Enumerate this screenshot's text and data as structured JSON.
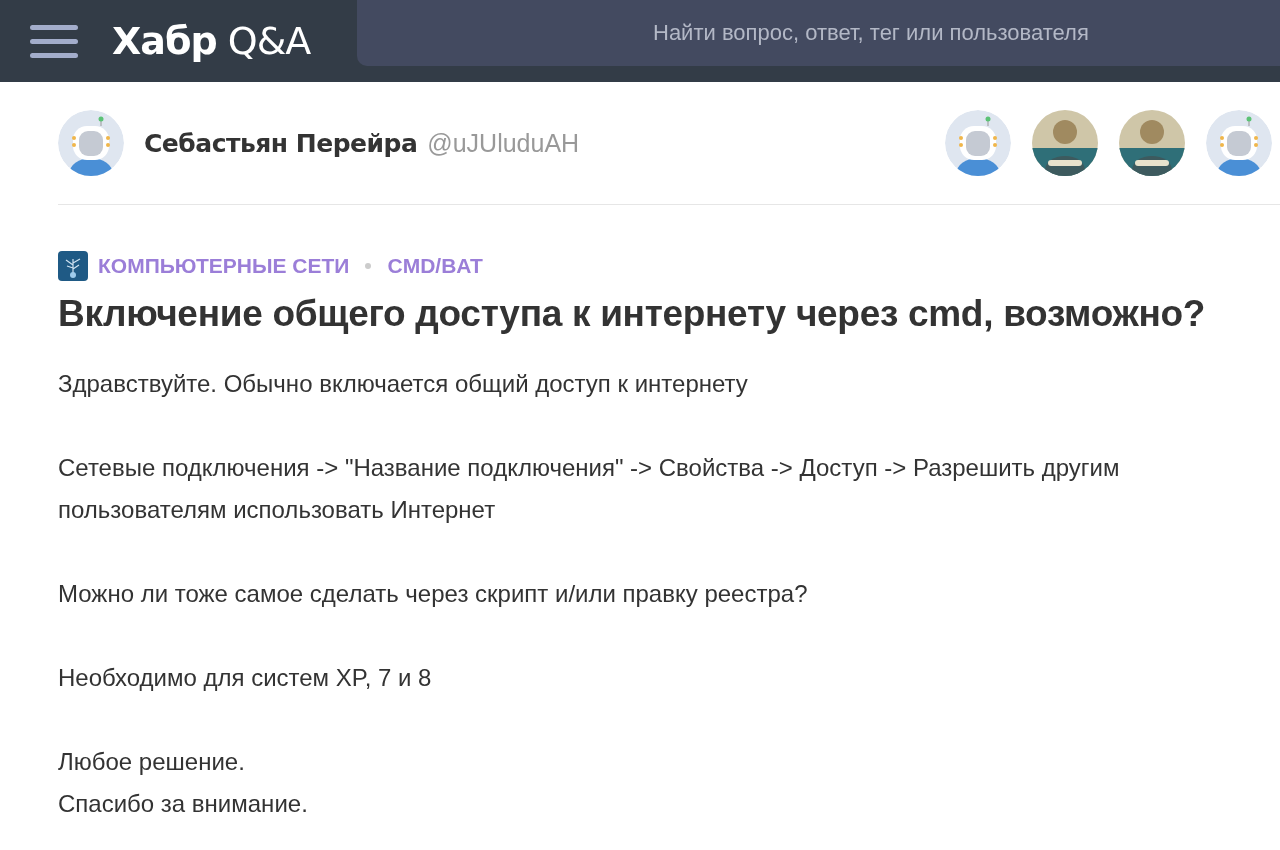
{
  "header": {
    "logo_bold": "Хабр",
    "logo_light": "Q&A",
    "search": {
      "placeholder": "Найти вопрос, ответ, тег или пользователя"
    }
  },
  "author": {
    "name": "Себастьян Перейра",
    "handle": "@uJUluduAH",
    "avatar": {
      "kind": "robot"
    }
  },
  "watchers": [
    {
      "kind": "robot"
    },
    {
      "kind": "picture"
    },
    {
      "kind": "picture"
    },
    {
      "kind": "robot"
    }
  ],
  "tags": [
    "КОМПЬЮТЕРНЫЕ СЕТИ",
    "CMD/BAT"
  ],
  "title": "Включение общего доступа к интернету через cmd, возможно?",
  "paragraphs": [
    [
      "Здравствуйте. Обычно включается общий доступ к интернету"
    ],
    [
      "Сетевые подключения -> \"Название подключения\" -> Свойства -> Доступ -> Разрешить другим пользователям использовать Интернет"
    ],
    [
      "Можно ли тоже самое сделать через скрипт и/или правку реестра?"
    ],
    [
      "Необходимо для систем XP, 7 и 8"
    ],
    [
      "Любое решение.",
      "Спасибо за внимание."
    ]
  ]
}
